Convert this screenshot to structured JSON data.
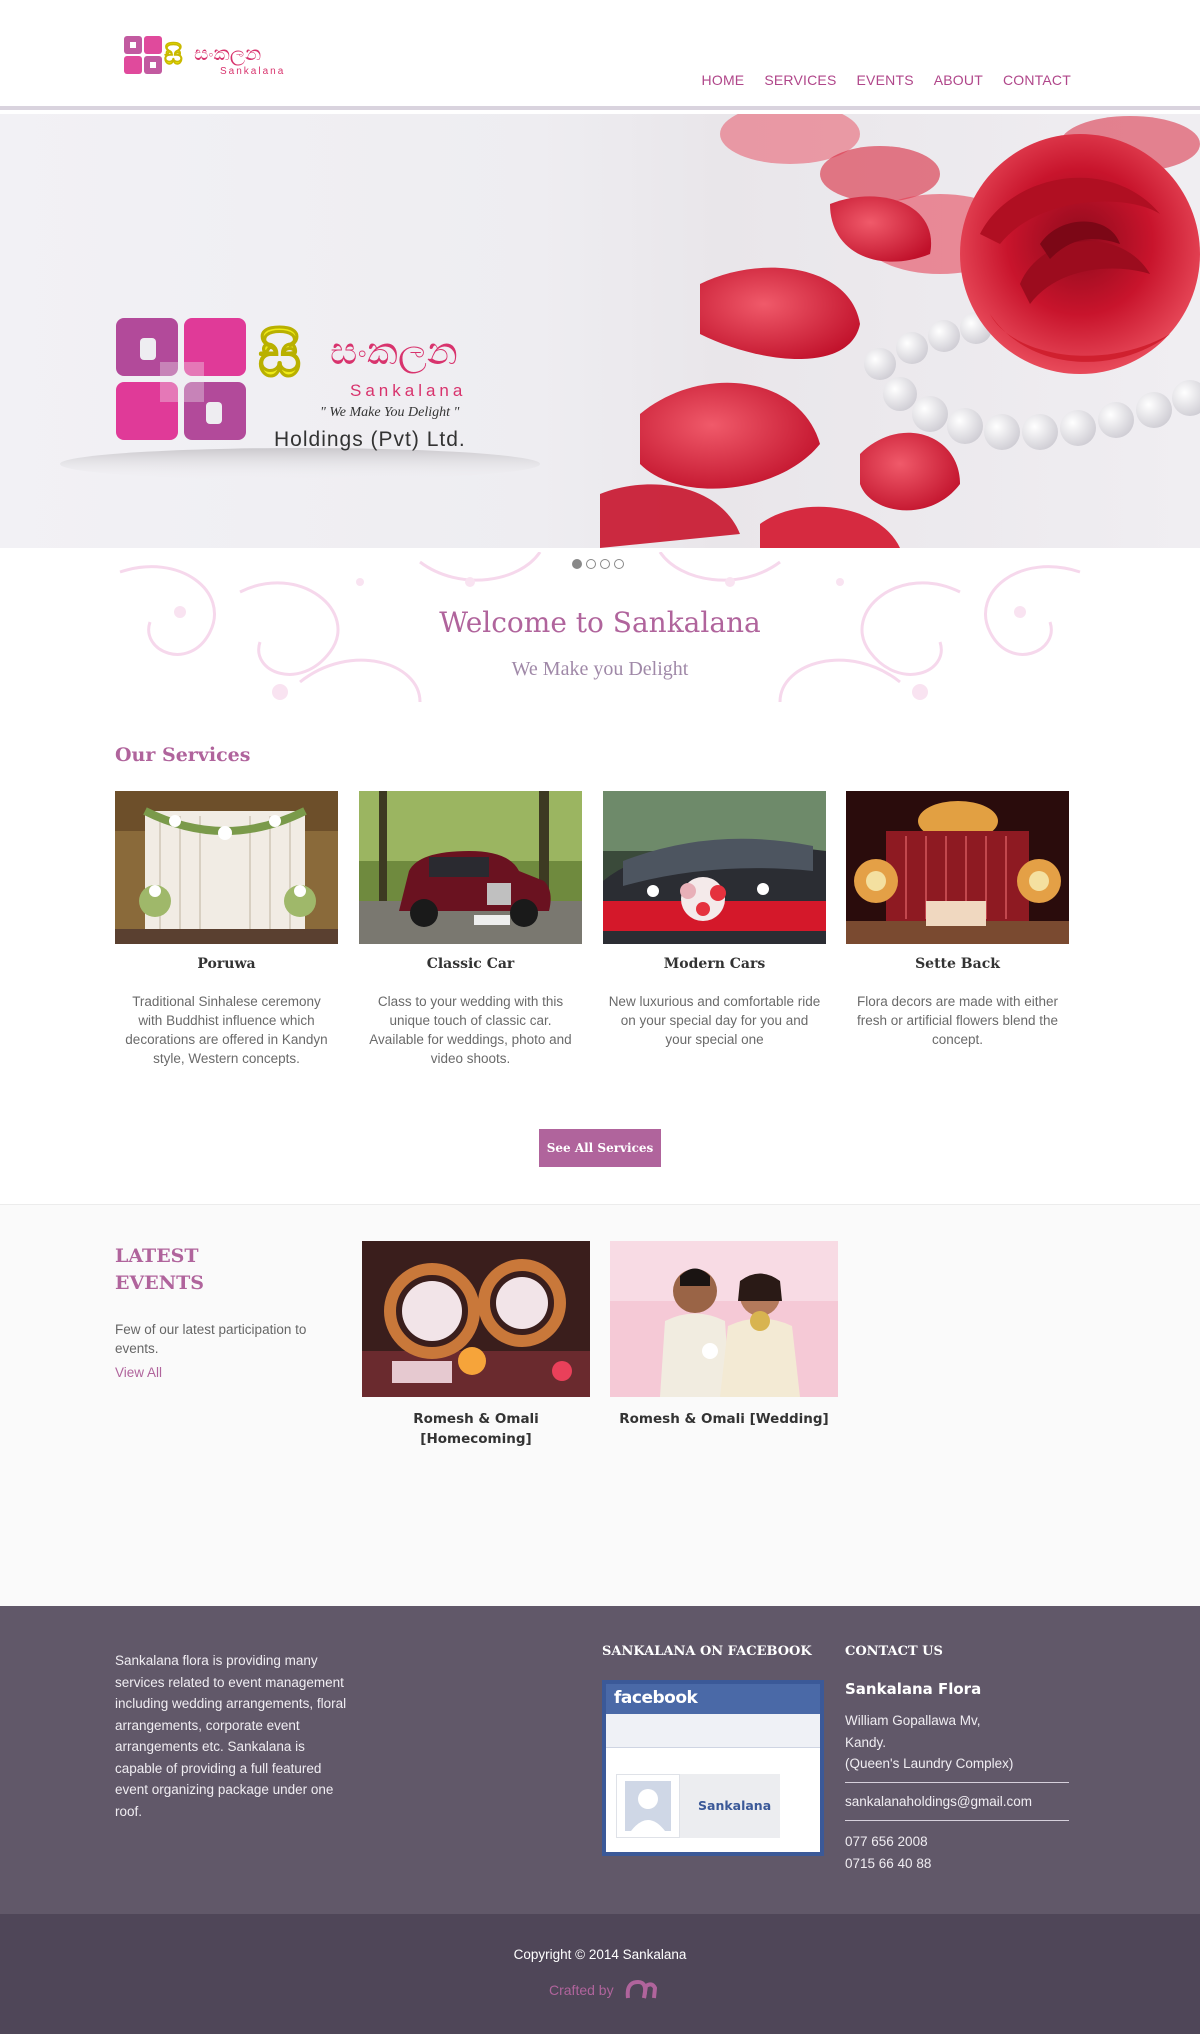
{
  "header": {
    "logo_text_si": "සංකලන",
    "logo_text_en": "Sankalana",
    "nav": [
      "HOME",
      "SERVICES",
      "EVENTS",
      "ABOUT",
      "CONTACT"
    ]
  },
  "hero": {
    "logo_text_si": "සංකලන",
    "logo_text_en": "Sankalana",
    "tagline": "\" We Make You Delight \"",
    "company": "Holdings (Pvt) Ltd.",
    "slides": 4,
    "active_slide": 1
  },
  "welcome": {
    "title": "Welcome to Sankalana",
    "subtitle": "We Make you Delight"
  },
  "services": {
    "title": "Our Services",
    "items": [
      {
        "name": "Poruwa",
        "desc": "Traditional Sinhalese ceremony with Buddhist influence which decorations are offered in Kandyn style, Western concepts."
      },
      {
        "name": "Classic Car",
        "desc": "Class to your wedding with this unique touch of classic car. Available for weddings, photo and video shoots."
      },
      {
        "name": "Modern Cars",
        "desc": "New luxurious and comfortable ride on your special day for you and your special one"
      },
      {
        "name": "Sette Back",
        "desc": "Flora decors are made with either fresh or artificial flowers blend the concept."
      }
    ],
    "see_all": "See All Services"
  },
  "events": {
    "title": "LATEST EVENTS",
    "desc": "Few of our latest participation to events.",
    "view_all": "View All",
    "items": [
      {
        "caption": "Romesh & Omali [Homecoming]"
      },
      {
        "caption": "Romesh & Omali [Wedding]"
      }
    ]
  },
  "footer": {
    "about": "Sankalana flora is providing many services related to event management including wedding arrangements, floral arrangements, corporate event arrangements etc. Sankalana is capable of providing a full featured event organizing package under one roof.",
    "facebook_title": "SANKALANA ON FACEBOOK",
    "facebook_logo": "facebook",
    "facebook_page": "Sankalana",
    "contact_title": "CONTACT US",
    "contact_name": "Sankalana Flora",
    "address": [
      "William Gopallawa Mv,",
      "Kandy.",
      "(Queen's Laundry Complex)"
    ],
    "email": "sankalanaholdings@gmail.com",
    "phones": [
      "077 656 2008",
      "0715 66 40 88"
    ]
  },
  "bottom": {
    "copyright": "Copyright © 2014 Sankalana",
    "crafted_by": "Crafted by"
  },
  "colors": {
    "brand": "#b0649c",
    "nav": "#b0468a",
    "footer": "#615869",
    "bottom": "#4f4658"
  }
}
